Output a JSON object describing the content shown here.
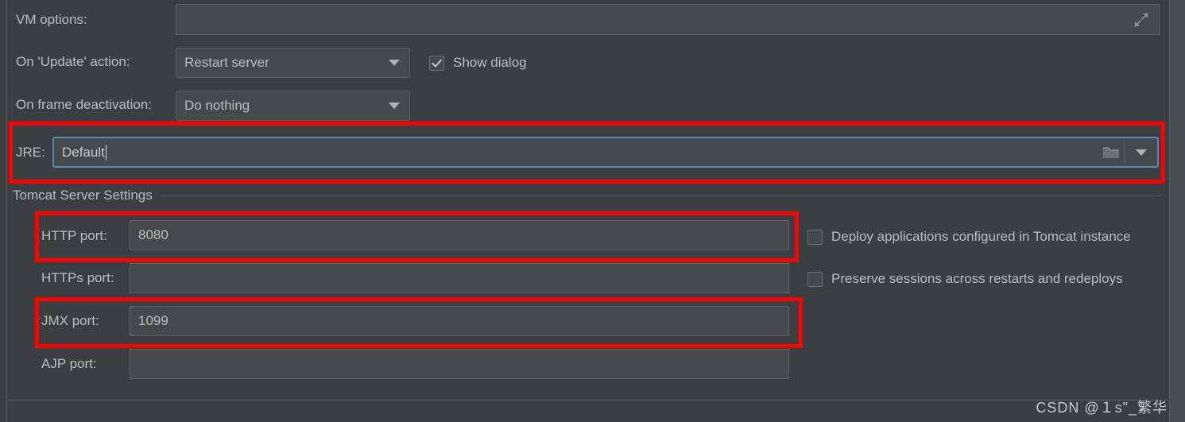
{
  "form": {
    "vm_options": {
      "label": "VM options:",
      "value": "",
      "placeholder": "",
      "expand_icon": "expand-arrows-icon"
    },
    "update_action": {
      "label": "On 'Update' action:",
      "value": "Restart server",
      "caret_icon": "chevron-down-icon"
    },
    "show_dialog": {
      "label": "Show dialog",
      "checked": true
    },
    "frame_deactivation": {
      "label": "On frame deactivation:",
      "value": "Do nothing",
      "caret_icon": "chevron-down-icon"
    },
    "jre": {
      "label": "JRE:",
      "value": "Default",
      "browse_icon": "folder-icon",
      "dropdown_icon": "chevron-down-icon"
    }
  },
  "tomcat": {
    "group_title": "Tomcat Server Settings",
    "ports": [
      {
        "label": "HTTP port:",
        "value": "8080"
      },
      {
        "label": "HTTPs port:",
        "value": ""
      },
      {
        "label": "JMX port:",
        "value": "1099"
      },
      {
        "label": "AJP port:",
        "value": ""
      }
    ],
    "options": [
      {
        "label": "Deploy applications configured in Tomcat instance",
        "checked": false
      },
      {
        "label": "Preserve sessions across restarts and redeploys",
        "checked": false
      }
    ]
  },
  "annotations": {
    "highlight_color": "#fd0000",
    "boxes": [
      {
        "name": "jre-highlight",
        "target": "JRE:"
      },
      {
        "name": "http-highlight",
        "target": "HTTP port:"
      },
      {
        "name": "jmx-highlight",
        "target": "JMX port:"
      }
    ]
  },
  "watermark": {
    "text": "CSDN @１s\"_繁华"
  },
  "theme": {
    "background": "#3c3f41",
    "field_background": "#45494a",
    "field_border": "#5e6264",
    "text": "#bcbcbc",
    "focus_border": "#5b86b6"
  }
}
